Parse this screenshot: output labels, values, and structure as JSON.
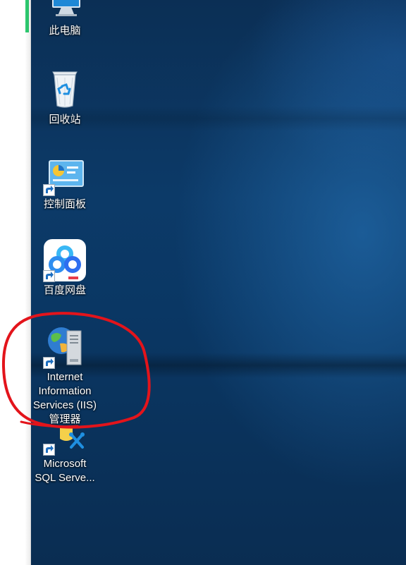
{
  "desktop": {
    "icons": [
      {
        "label": "此电脑",
        "icon": "computer-icon"
      },
      {
        "label": "回收站",
        "icon": "recycle-bin-icon"
      },
      {
        "label": "控制面板",
        "icon": "control-panel-icon"
      },
      {
        "label": "百度网盘",
        "icon": "baidu-netdisk-icon"
      },
      {
        "label": "Internet Information Services (IIS) 管理器",
        "icon": "iis-manager-icon",
        "label_lines": [
          "Internet",
          "Information",
          "Services (IIS)",
          "管理器"
        ]
      },
      {
        "label": "Microsoft SQL Serve...",
        "icon": "sql-server-icon",
        "label_lines": [
          "Microsoft",
          "SQL Serve..."
        ]
      }
    ]
  },
  "annotation": {
    "shape": "circle",
    "color": "#e3141b",
    "target": "Internet Information Services (IIS) 管理器"
  },
  "colors": {
    "accent_green": "#2ecc71",
    "desktop_blue": "#0c3a68"
  }
}
